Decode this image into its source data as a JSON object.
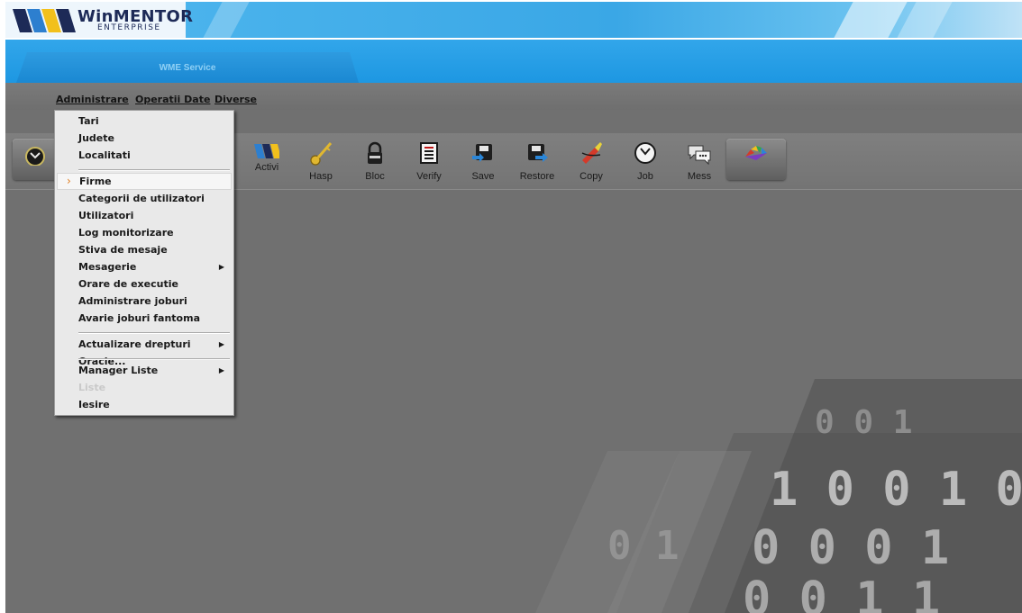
{
  "app": {
    "logo_text": "WinMENTOR",
    "logo_sub": "ENTERPRISE",
    "tab_label": "WME Service"
  },
  "menubar": {
    "items": [
      "Administrare",
      "Operatii Date",
      "Diverse"
    ]
  },
  "toolbar": {
    "buttons": [
      {
        "label": "",
        "icon": "clock-icon"
      },
      {
        "label": "Activi",
        "icon": "logo-stripes-icon"
      },
      {
        "label": "Hasp",
        "icon": "key-icon"
      },
      {
        "label": "Bloc",
        "icon": "padlock-icon"
      },
      {
        "label": "Verify",
        "icon": "checklist-icon"
      },
      {
        "label": "Save",
        "icon": "save-icon"
      },
      {
        "label": "Restore",
        "icon": "restore-icon"
      },
      {
        "label": "Copy",
        "icon": "copy-icon"
      },
      {
        "label": "Job",
        "icon": "clock-icon"
      },
      {
        "label": "Mess",
        "icon": "chat-icon"
      },
      {
        "label": "",
        "icon": "color-palette-icon"
      }
    ]
  },
  "dropdown": {
    "items": [
      {
        "label": "Tari"
      },
      {
        "label": "Judete"
      },
      {
        "label": "Localitati"
      },
      {
        "label": "Firme",
        "highlighted": true
      },
      {
        "label": "Categorii de utilizatori"
      },
      {
        "label": "Utilizatori"
      },
      {
        "label": "Log monitorizare"
      },
      {
        "label": "Stiva de mesaje"
      },
      {
        "label": "Mesagerie",
        "submenu": true
      },
      {
        "label": "Orare de executie"
      },
      {
        "label": "Administrare joburi"
      },
      {
        "label": "Avarie joburi fantoma"
      },
      {
        "label": "Actualizare drepturi Oracle...",
        "submenu": true
      },
      {
        "label": "Manager Liste",
        "submenu": true
      },
      {
        "label": "Liste",
        "disabled": true
      },
      {
        "label": "Iesire"
      }
    ]
  },
  "colors": {
    "banner_blue": "#3aa7e6",
    "workspace_gray": "#707070",
    "menu_bg": "#e9e9e9",
    "highlight_marker": "#e07a1a"
  }
}
